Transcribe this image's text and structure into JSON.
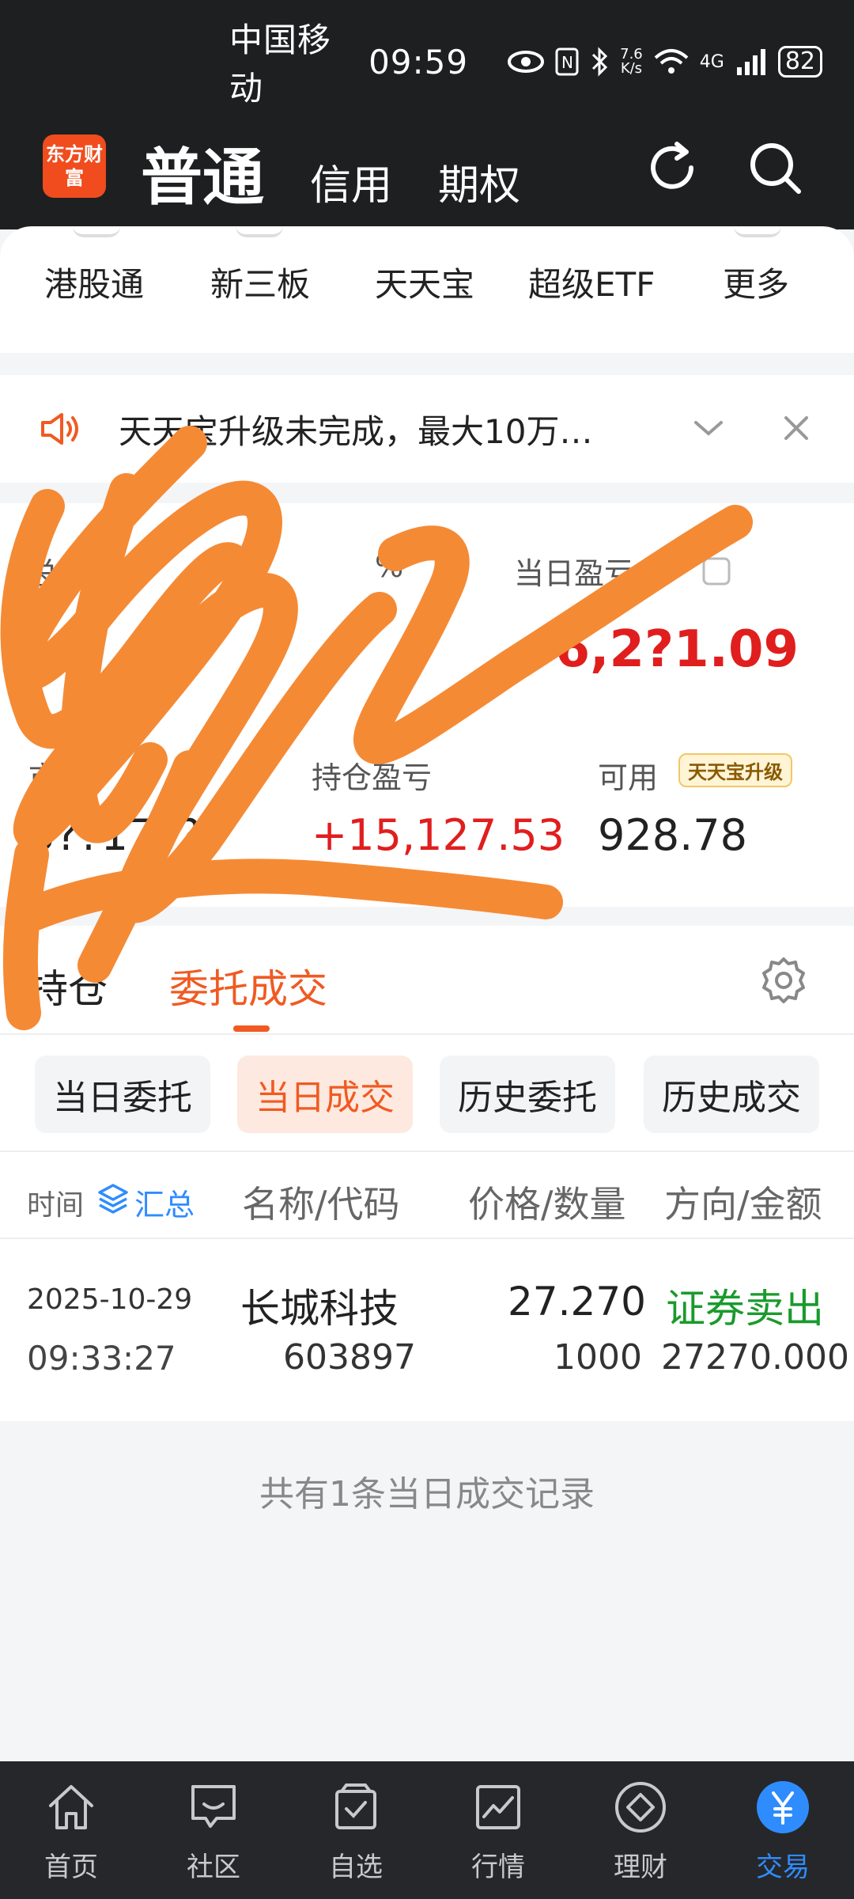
{
  "status_bar": {
    "carrier": "中国移动",
    "time": "09:59",
    "net_speed_value": "7.6",
    "net_speed_unit": "K/s",
    "network": "4G",
    "battery": "82"
  },
  "header": {
    "logo_text": "东方财富",
    "tabs": [
      "普通",
      "信用",
      "期权"
    ]
  },
  "quick_entries": [
    "港股通",
    "新三板",
    "天天宝",
    "超级ETF",
    "更多"
  ],
  "notice": {
    "text": "天天宝升级未完成，最大10万…"
  },
  "assets": {
    "total_label": "总资产",
    "total_percent_hint": "%",
    "daily_pnl_label": "当日盈亏",
    "daily_pnl_value": "+6,2?1.09",
    "market_value_label": "市值",
    "market_value_value": "5??17??",
    "position_pnl_label": "持仓盈亏",
    "position_pnl_value": "+15,127.53",
    "available_label": "可用",
    "available_badge": "天天宝升级",
    "available_value": "928.78"
  },
  "section_tabs": {
    "holdings": "持仓",
    "orders": "委托成交"
  },
  "filter_chips": [
    "当日委托",
    "当日成交",
    "历史委托",
    "历史成交"
  ],
  "table": {
    "headers": {
      "time": "时间",
      "summary": "汇总",
      "name_code": "名称/代码",
      "price_qty": "价格/数量",
      "dir_amount": "方向/金额"
    },
    "rows": [
      {
        "date": "2025-10-29",
        "time": "09:33:27",
        "name": "长城科技",
        "code": "603897",
        "price": "27.270",
        "qty": "1000",
        "direction": "证券卖出",
        "amount": "27270.000"
      }
    ]
  },
  "summary_text": "共有1条当日成交记录",
  "bottom_nav": [
    {
      "label": "首页",
      "icon": "home-icon"
    },
    {
      "label": "社区",
      "icon": "chat-icon"
    },
    {
      "label": "自选",
      "icon": "watchlist-icon"
    },
    {
      "label": "行情",
      "icon": "chart-icon"
    },
    {
      "label": "理财",
      "icon": "diamond-icon"
    },
    {
      "label": "交易",
      "icon": "yuan-icon"
    }
  ],
  "colors": {
    "accent": "#f05a22",
    "up_red": "#e01e1e",
    "sell_green": "#1a9a2c",
    "nav_active": "#2f8cff",
    "scribble": "#f58a35"
  }
}
